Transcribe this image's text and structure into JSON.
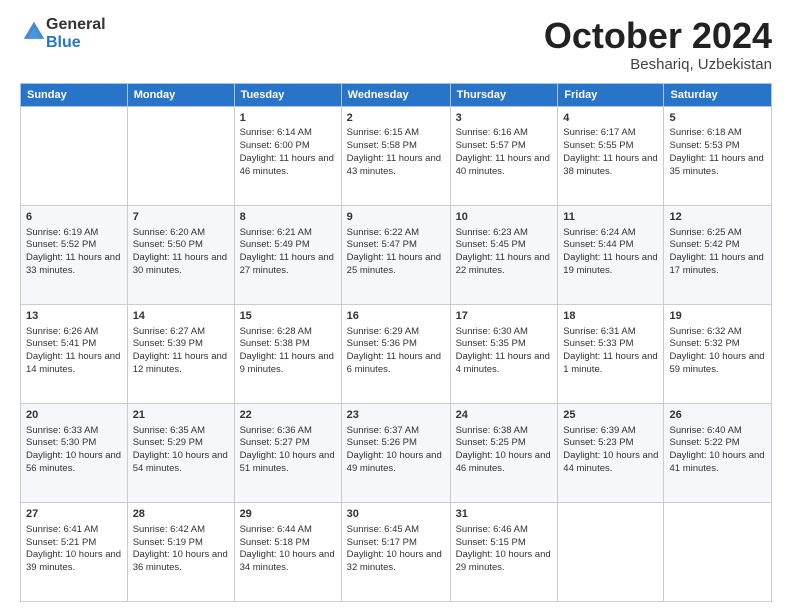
{
  "header": {
    "logo_line1": "General",
    "logo_line2": "Blue",
    "month": "October 2024",
    "location": "Beshariq, Uzbekistan"
  },
  "days_of_week": [
    "Sunday",
    "Monday",
    "Tuesday",
    "Wednesday",
    "Thursday",
    "Friday",
    "Saturday"
  ],
  "weeks": [
    [
      {
        "day": "",
        "info": ""
      },
      {
        "day": "",
        "info": ""
      },
      {
        "day": "1",
        "info": "Sunrise: 6:14 AM\nSunset: 6:00 PM\nDaylight: 11 hours and 46 minutes."
      },
      {
        "day": "2",
        "info": "Sunrise: 6:15 AM\nSunset: 5:58 PM\nDaylight: 11 hours and 43 minutes."
      },
      {
        "day": "3",
        "info": "Sunrise: 6:16 AM\nSunset: 5:57 PM\nDaylight: 11 hours and 40 minutes."
      },
      {
        "day": "4",
        "info": "Sunrise: 6:17 AM\nSunset: 5:55 PM\nDaylight: 11 hours and 38 minutes."
      },
      {
        "day": "5",
        "info": "Sunrise: 6:18 AM\nSunset: 5:53 PM\nDaylight: 11 hours and 35 minutes."
      }
    ],
    [
      {
        "day": "6",
        "info": "Sunrise: 6:19 AM\nSunset: 5:52 PM\nDaylight: 11 hours and 33 minutes."
      },
      {
        "day": "7",
        "info": "Sunrise: 6:20 AM\nSunset: 5:50 PM\nDaylight: 11 hours and 30 minutes."
      },
      {
        "day": "8",
        "info": "Sunrise: 6:21 AM\nSunset: 5:49 PM\nDaylight: 11 hours and 27 minutes."
      },
      {
        "day": "9",
        "info": "Sunrise: 6:22 AM\nSunset: 5:47 PM\nDaylight: 11 hours and 25 minutes."
      },
      {
        "day": "10",
        "info": "Sunrise: 6:23 AM\nSunset: 5:45 PM\nDaylight: 11 hours and 22 minutes."
      },
      {
        "day": "11",
        "info": "Sunrise: 6:24 AM\nSunset: 5:44 PM\nDaylight: 11 hours and 19 minutes."
      },
      {
        "day": "12",
        "info": "Sunrise: 6:25 AM\nSunset: 5:42 PM\nDaylight: 11 hours and 17 minutes."
      }
    ],
    [
      {
        "day": "13",
        "info": "Sunrise: 6:26 AM\nSunset: 5:41 PM\nDaylight: 11 hours and 14 minutes."
      },
      {
        "day": "14",
        "info": "Sunrise: 6:27 AM\nSunset: 5:39 PM\nDaylight: 11 hours and 12 minutes."
      },
      {
        "day": "15",
        "info": "Sunrise: 6:28 AM\nSunset: 5:38 PM\nDaylight: 11 hours and 9 minutes."
      },
      {
        "day": "16",
        "info": "Sunrise: 6:29 AM\nSunset: 5:36 PM\nDaylight: 11 hours and 6 minutes."
      },
      {
        "day": "17",
        "info": "Sunrise: 6:30 AM\nSunset: 5:35 PM\nDaylight: 11 hours and 4 minutes."
      },
      {
        "day": "18",
        "info": "Sunrise: 6:31 AM\nSunset: 5:33 PM\nDaylight: 11 hours and 1 minute."
      },
      {
        "day": "19",
        "info": "Sunrise: 6:32 AM\nSunset: 5:32 PM\nDaylight: 10 hours and 59 minutes."
      }
    ],
    [
      {
        "day": "20",
        "info": "Sunrise: 6:33 AM\nSunset: 5:30 PM\nDaylight: 10 hours and 56 minutes."
      },
      {
        "day": "21",
        "info": "Sunrise: 6:35 AM\nSunset: 5:29 PM\nDaylight: 10 hours and 54 minutes."
      },
      {
        "day": "22",
        "info": "Sunrise: 6:36 AM\nSunset: 5:27 PM\nDaylight: 10 hours and 51 minutes."
      },
      {
        "day": "23",
        "info": "Sunrise: 6:37 AM\nSunset: 5:26 PM\nDaylight: 10 hours and 49 minutes."
      },
      {
        "day": "24",
        "info": "Sunrise: 6:38 AM\nSunset: 5:25 PM\nDaylight: 10 hours and 46 minutes."
      },
      {
        "day": "25",
        "info": "Sunrise: 6:39 AM\nSunset: 5:23 PM\nDaylight: 10 hours and 44 minutes."
      },
      {
        "day": "26",
        "info": "Sunrise: 6:40 AM\nSunset: 5:22 PM\nDaylight: 10 hours and 41 minutes."
      }
    ],
    [
      {
        "day": "27",
        "info": "Sunrise: 6:41 AM\nSunset: 5:21 PM\nDaylight: 10 hours and 39 minutes."
      },
      {
        "day": "28",
        "info": "Sunrise: 6:42 AM\nSunset: 5:19 PM\nDaylight: 10 hours and 36 minutes."
      },
      {
        "day": "29",
        "info": "Sunrise: 6:44 AM\nSunset: 5:18 PM\nDaylight: 10 hours and 34 minutes."
      },
      {
        "day": "30",
        "info": "Sunrise: 6:45 AM\nSunset: 5:17 PM\nDaylight: 10 hours and 32 minutes."
      },
      {
        "day": "31",
        "info": "Sunrise: 6:46 AM\nSunset: 5:15 PM\nDaylight: 10 hours and 29 minutes."
      },
      {
        "day": "",
        "info": ""
      },
      {
        "day": "",
        "info": ""
      }
    ]
  ]
}
